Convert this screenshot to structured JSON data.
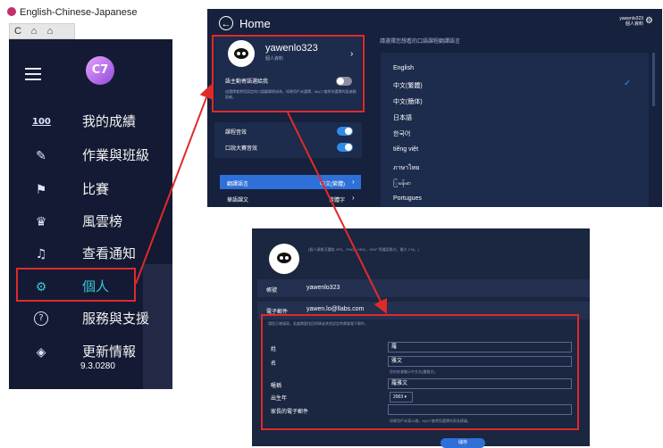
{
  "browser": {
    "tab_title": "English-Chinese-Japanese",
    "nav": [
      "C",
      "⌂",
      "⌂"
    ]
  },
  "sidebar": {
    "logo": "C7",
    "items": [
      {
        "label": "我的成績",
        "icon": "100"
      },
      {
        "label": "作業與班級",
        "icon": "✎"
      },
      {
        "label": "比賽",
        "icon": "⚑"
      },
      {
        "label": "風雲榜",
        "icon": "♛"
      },
      {
        "label": "查看通知",
        "icon": "♫"
      },
      {
        "label": "個人",
        "icon": "⚙"
      },
      {
        "label": "服務與支援",
        "icon": "?"
      },
      {
        "label": "更新情報",
        "icon": "◈"
      }
    ],
    "version": "9.3.0280"
  },
  "home": {
    "title": "Home",
    "profile": {
      "username": "yawenlo323",
      "subtitle": "個人資料"
    },
    "header_user": "yawenlo323",
    "header_sub": "個人資料",
    "auto_play_label": "語主動寄語選給我",
    "auto_play_desc": "這選擇會將您設定的口語翻譯將成為，如果用戶未選擇，MyC7會將你選擇的語者翻語者。",
    "sounds": [
      {
        "label": "課程音效"
      },
      {
        "label": "口說大賽音效"
      }
    ],
    "translate_row": {
      "label": "翻譯語言",
      "value": "中文(繁體)"
    },
    "reading_row": {
      "label": "華語課文",
      "value": "繁體字"
    },
    "lang_prompt": "請選擇您想看的口語課程翻譯語言",
    "languages": [
      "English",
      "中文(繁體)",
      "中文(簡体)",
      "日本語",
      "한국어",
      "tiếng việt",
      "ภาษาไทย",
      "ြမန်မာ",
      "Portugues"
    ],
    "selected_language": "中文(繁體)"
  },
  "account": {
    "top_note": "(個人頭像可選取 JPG、PNG、HEIC、HEIF 等檔案格式，最大 2 M。)",
    "account_label": "帳號",
    "account_value": "yawenlo323",
    "email_label": "電子郵件",
    "email_value": "yawen.lo@llabs.com",
    "info_note": "請您正確填寫，若當需要找回密碼或其他設定時需要電子郵件。",
    "fields": [
      {
        "label": "姓",
        "value": "羅"
      },
      {
        "label": "名",
        "value": "雅文"
      },
      {
        "label": "暱稱",
        "value": "羅雅文"
      },
      {
        "label": "出生年",
        "value": "2003"
      },
      {
        "label": "家長的電子郵件",
        "value": ""
      }
    ],
    "name_hint": "您的姓會顯示中文名(羅雅文)",
    "parent_hint": "如果用戶未滿13歲，MyC7會將您選擇的家長建議。",
    "save_label": "儲存"
  },
  "colors": {
    "highlight": "#e02a2a",
    "accent": "#37c6d6",
    "primary": "#2f6fd8"
  }
}
